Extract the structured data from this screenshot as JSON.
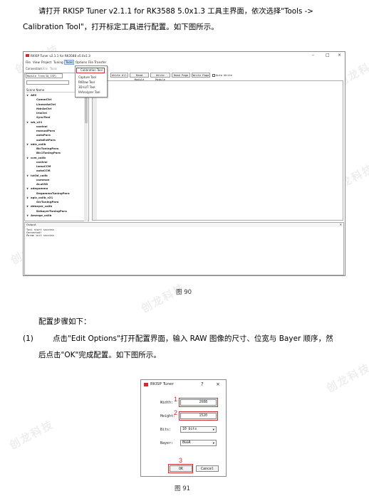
{
  "intro_text": "请打开 RKISP Tuner v2.1.1 for RK3588 5.0x1.3 工具主界面，依次选择\"Tools ->",
  "intro_text_2": "Calibration Tool\"，打开标定工具进行配置。如下图所示。",
  "watermark": "创龙科技",
  "main_window": {
    "title": "RKISP Tuner v2.1.1 for RK3588 v5.0x1.3",
    "window_buttons": [
      "–",
      "□",
      "×"
    ],
    "menu": [
      "File",
      "View",
      "Project",
      "Tuning",
      "Tools",
      "Options",
      "File Transfer"
    ],
    "ribbon": [
      "Connection",
      "Utils",
      "Tools"
    ],
    "tools_menu": [
      "Calibration Tool",
      "Capture Tool",
      "RKRaw Tool",
      "3D-LUT Tool",
      "IAAnalyzer Tool"
    ],
    "toolbar_buttons": [
      "Write All",
      "Read Module",
      "Write Module",
      "Read Page",
      "Write Page"
    ],
    "auto_write": "Auto Write",
    "module_select": "Module Tree(IQ_ISP)",
    "scene_header": "Scene Name",
    "tree": [
      {
        "label": "AEC",
        "level": 0
      },
      {
        "label": "CommCtrl",
        "level": 1
      },
      {
        "label": "LinearAeCtrl",
        "level": 1
      },
      {
        "label": "HdrAeCtrl",
        "level": 1
      },
      {
        "label": "IrisCtrl",
        "level": 1
      },
      {
        "label": "SyncTest",
        "level": 1
      },
      {
        "label": "wb_v21",
        "level": 0
      },
      {
        "label": "control",
        "level": 1
      },
      {
        "label": "manualPara",
        "level": 1
      },
      {
        "label": "autoPara",
        "level": 1
      },
      {
        "label": "autoExtPara",
        "level": 1
      },
      {
        "label": "ablc_calib",
        "level": 0
      },
      {
        "label": "BlcTuningPara",
        "level": 1
      },
      {
        "label": "Blc1TuningPara",
        "level": 1
      },
      {
        "label": "ccm_calib",
        "level": 0
      },
      {
        "label": "control",
        "level": 1
      },
      {
        "label": "lumaCCM",
        "level": 1
      },
      {
        "label": "autoCCM",
        "level": 1
      },
      {
        "label": "lut3d_calib",
        "level": 0
      },
      {
        "label": "common",
        "level": 1
      },
      {
        "label": "ALut3D",
        "level": 1
      },
      {
        "label": "adegamma",
        "level": 0
      },
      {
        "label": "DegammaTuningPara",
        "level": 1
      },
      {
        "label": "agic_calib_v21",
        "level": 0
      },
      {
        "label": "GicTuningPara",
        "level": 1
      },
      {
        "label": "debayer_calib",
        "level": 0
      },
      {
        "label": "DebayerTuningPara",
        "level": 1
      },
      {
        "label": "Amerge_calib",
        "level": 0
      }
    ],
    "output_title": "Output",
    "output_lines": [
      "Tool start success",
      "Connected!",
      "Param init success"
    ]
  },
  "figure_90_caption": "图 90",
  "config_steps_heading": "配置步骤如下：",
  "step1_num": "(1)",
  "step1_text": "点击\"Edit Options\"打开配置界面，输入 RAW 图像的尺寸、位宽与 Bayer 顺序，然",
  "step1_text_2": "后点击\"OK\"完成配置。如下图所示。",
  "dialog": {
    "title": "RKISP Tuner",
    "help": "?",
    "close": "×",
    "width_label": "Width:",
    "width_value": "2688",
    "height_label": "Height:",
    "height_value": "1520",
    "bits_label": "Bits:",
    "bits_value": "10 bits",
    "bayer_label": "Bayer:",
    "bayer_value": "BGGR",
    "ok_label": "OK",
    "cancel_label": "Cancel",
    "markers": [
      "1",
      "2",
      "3"
    ]
  },
  "figure_91_caption": "图 91",
  "colors": {
    "highlight_red": "#d42b2b",
    "menu_active": "#cfe3f7"
  }
}
